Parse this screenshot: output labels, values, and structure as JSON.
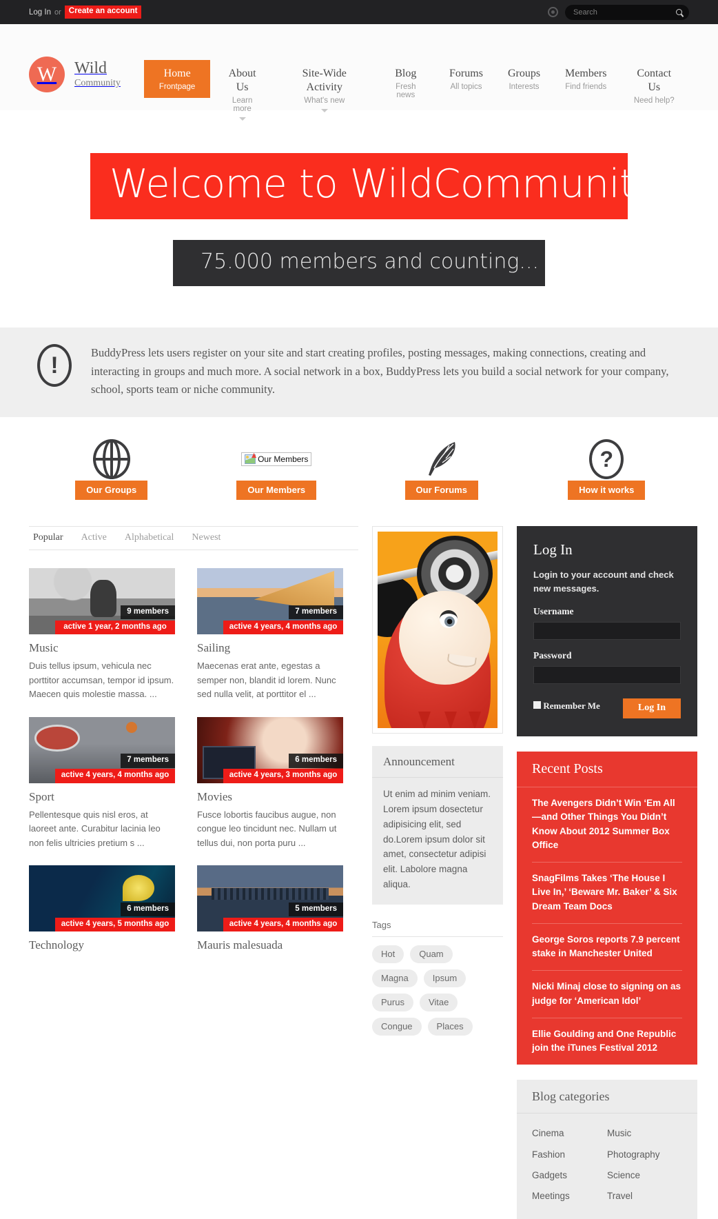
{
  "topbar": {
    "login_label": "Log In",
    "or_label": "or",
    "create_label": "Create an account",
    "search_placeholder": "Search",
    "search_value": ""
  },
  "brand": {
    "mark": "W",
    "name": "Wild",
    "sub": "Community"
  },
  "nav": [
    {
      "label": "Home",
      "sub": "Frontpage",
      "active": true,
      "caret": false
    },
    {
      "label": "About Us",
      "sub": "Learn more",
      "active": false,
      "caret": true
    },
    {
      "label": "Site-Wide Activity",
      "sub": "What's new",
      "active": false,
      "caret": true
    },
    {
      "label": "Blog",
      "sub": "Fresh news",
      "active": false,
      "caret": false
    },
    {
      "label": "Forums",
      "sub": "All topics",
      "active": false,
      "caret": false
    },
    {
      "label": "Groups",
      "sub": "Interests",
      "active": false,
      "caret": false
    },
    {
      "label": "Members",
      "sub": "Find friends",
      "active": false,
      "caret": false
    },
    {
      "label": "Contact Us",
      "sub": "Need help?",
      "active": false,
      "caret": false
    }
  ],
  "hero": {
    "title": "Welcome to WildCommunity",
    "subtitle": "75.000 members and counting...",
    "banner_color": "#fa2d1e",
    "sub_color": "#2f2f31"
  },
  "notice": {
    "icon": "exclamation-circle-icon",
    "text": "BuddyPress lets users register on your site and start creating profiles, posting messages, making connections, creating and interacting in groups and much more. A social network in a box, BuddyPress lets you build a social network for your company, school, sports team or niche community."
  },
  "features": [
    {
      "icon": "globe-icon",
      "label": "Our Groups"
    },
    {
      "icon": "broken-image-icon",
      "label": "Our Members",
      "alt_text": "Our Members",
      "broken": true
    },
    {
      "icon": "feather-icon",
      "label": "Our Forums"
    },
    {
      "icon": "question-mark-icon",
      "label": "How it works"
    }
  ],
  "groups": {
    "tabs": [
      {
        "label": "Popular",
        "active": true
      },
      {
        "label": "Active",
        "active": false
      },
      {
        "label": "Alphabetical",
        "active": false
      },
      {
        "label": "Newest",
        "active": false
      }
    ],
    "cards": [
      {
        "title": "Music",
        "members": "9 members",
        "active": "active 1 year, 2 months ago",
        "desc": "Duis tellus ipsum, vehicula nec porttitor accumsan, tempor id ipsum. Maecen quis molestie massa. ...",
        "art": "art-music"
      },
      {
        "title": "Sailing",
        "members": "7 members",
        "active": "active 4 years, 4 months ago",
        "desc": "Maecenas erat ante, egestas a semper non, blandit id lorem. Nunc sed nulla velit, at porttitor el ...",
        "art": "art-sailing"
      },
      {
        "title": "Sport",
        "members": "7 members",
        "active": "active 4 years, 4 months ago",
        "desc": "Pellentesque quis nisl eros, at laoreet ante. Curabitur lacinia leo non felis ultricies pretium s ...",
        "art": "art-sport"
      },
      {
        "title": "Movies",
        "members": "6 members",
        "active": "active 4 years, 3 months ago",
        "desc": "Fusce lobortis faucibus augue, non congue leo tincidunt nec. Nullam ut tellus dui, non porta puru ...",
        "art": "art-movies"
      },
      {
        "title": "Technology",
        "members": "6 members",
        "active": "active 4 years, 5 months ago",
        "desc": "",
        "art": "art-tech"
      },
      {
        "title": "Mauris malesuada",
        "members": "5 members",
        "active": "active 4 years, 4 months ago",
        "desc": "",
        "art": "art-city"
      }
    ]
  },
  "middle": {
    "illustration": "cartoon-weightlifter-image",
    "announcement": {
      "title": "Announcement",
      "body": "Ut enim ad minim veniam. Lorem ipsum dosectetur adipisicing elit, sed do.Lorem ipsum dolor sit amet, consectetur adipisi elit. Labolore magna aliqua."
    },
    "tags_title": "Tags",
    "tags": [
      "Hot",
      "Quam",
      "Magna",
      "Ipsum",
      "Purus",
      "Vitae",
      "Congue",
      "Places"
    ]
  },
  "sidebar": {
    "login": {
      "title": "Log In",
      "description": "Login to your account and check new messages.",
      "username_label": "Username",
      "username_value": "",
      "password_label": "Password",
      "password_value": "",
      "remember_label": "Remember Me",
      "button_label": "Log In"
    },
    "recent_posts": {
      "title": "Recent Posts",
      "accent": "#e8382f",
      "items": [
        "The Avengers Didn’t Win ‘Em All—and Other Things You Didn’t Know About 2012 Summer Box Office",
        "SnagFilms Takes ‘The House I Live In,’ ‘Beware Mr. Baker’ & Six Dream Team Docs",
        "George Soros reports 7.9 percent stake in Manchester United",
        "Nicki Minaj close to signing on as judge for ‘American Idol’",
        "Ellie Goulding and One Republic join the iTunes Festival 2012"
      ]
    },
    "blog_categories": {
      "title": "Blog categories",
      "items": [
        "Cinema",
        "Music",
        "Fashion",
        "Photography",
        "Gadgets",
        "Science",
        "Meetings",
        "Travel"
      ]
    }
  }
}
